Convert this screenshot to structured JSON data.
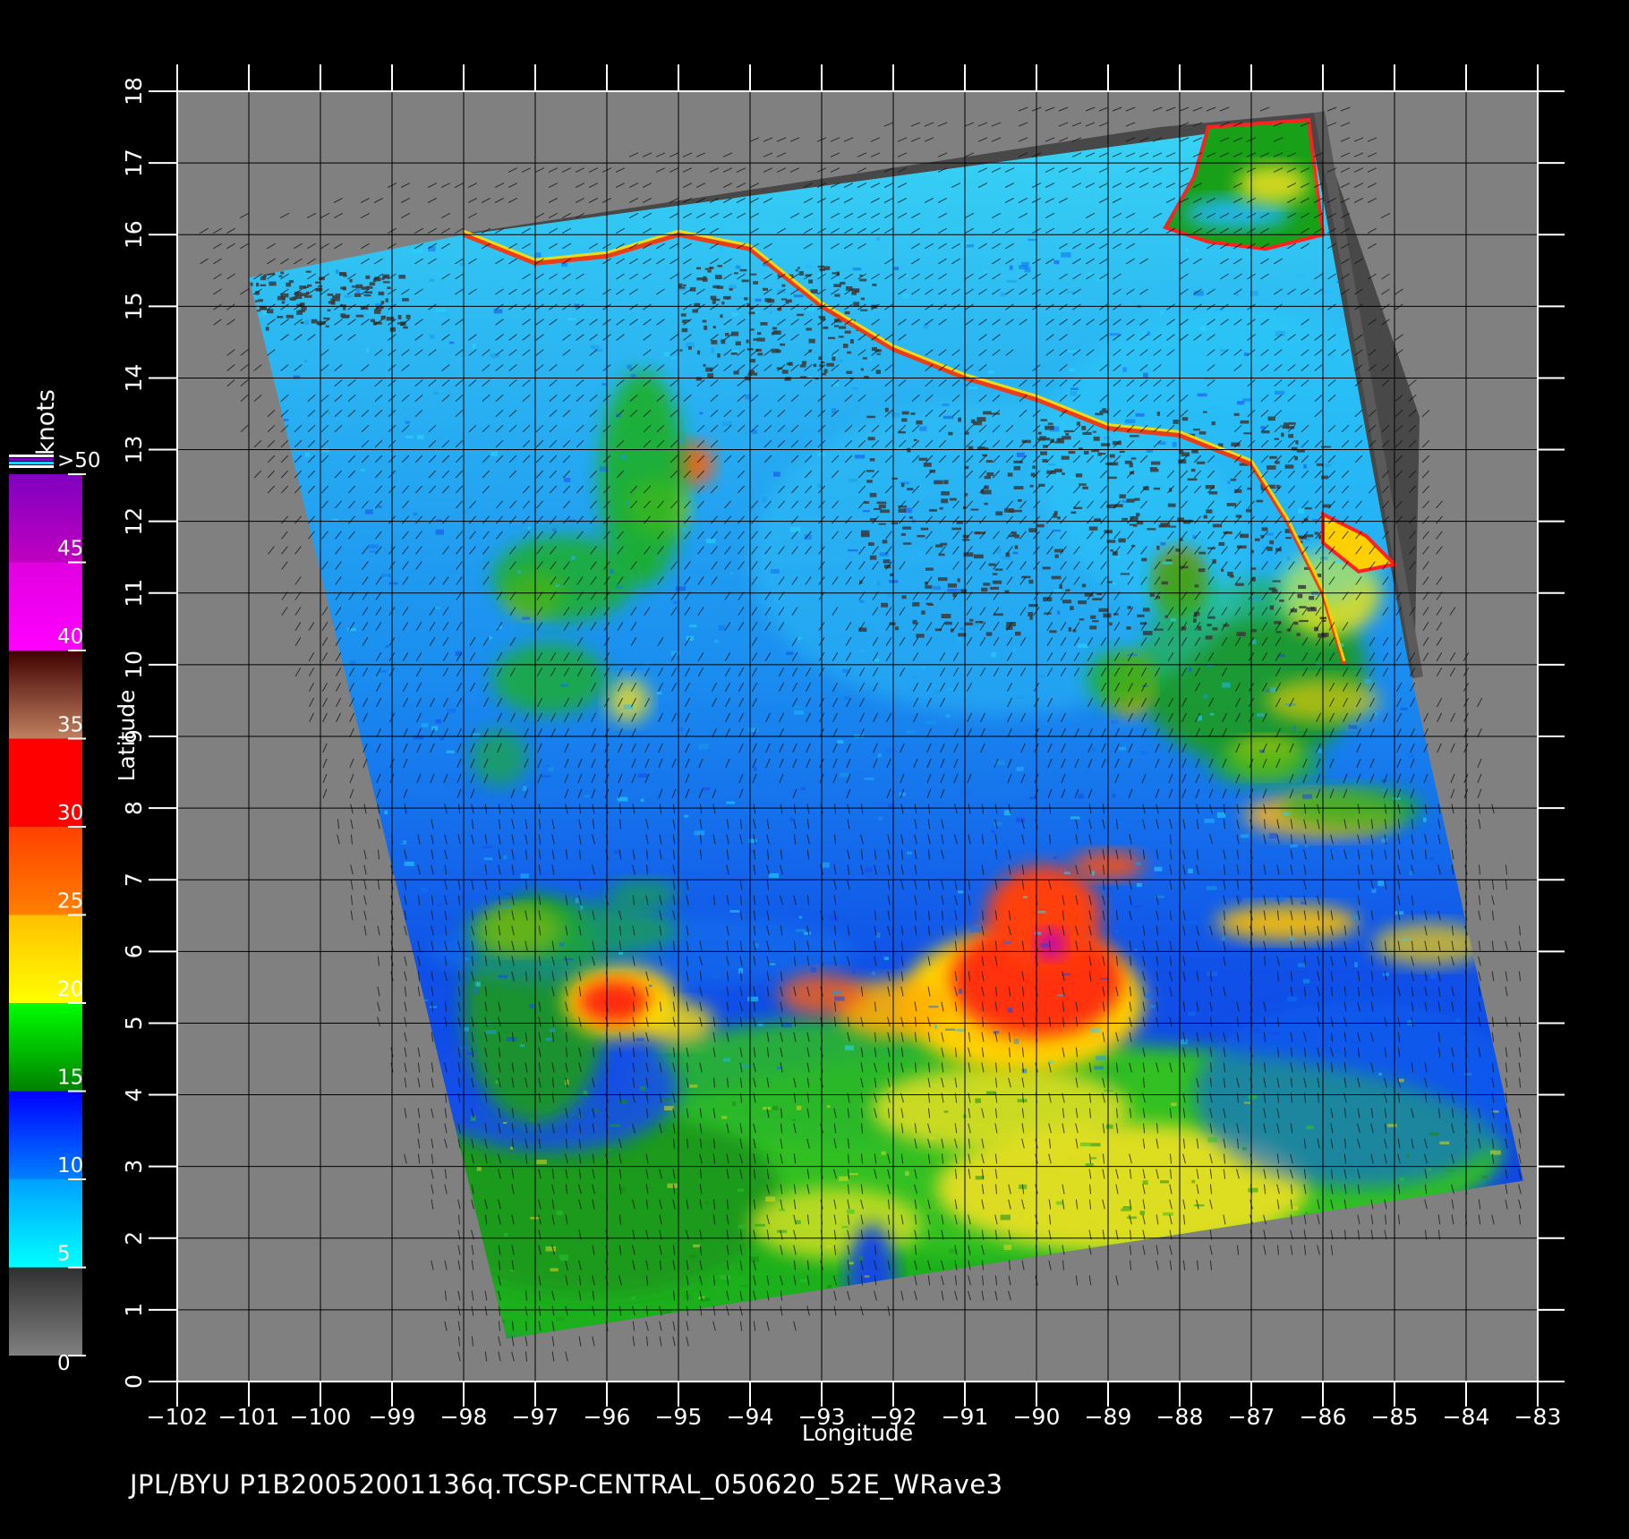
{
  "chart_data": {
    "type": "heatmap",
    "xlabel": "Longitude",
    "ylabel": "Latitude",
    "xlim": [
      -102,
      -83
    ],
    "ylim": [
      0,
      18
    ],
    "x_ticks": [
      "-102",
      "-101",
      "-100",
      "-99",
      "-98",
      "-97",
      "-96",
      "-95",
      "-94",
      "-93",
      "-92",
      "-91",
      "-90",
      "-89",
      "-88",
      "-87",
      "-86",
      "-85",
      "-84",
      "-83"
    ],
    "y_ticks": [
      "0",
      "1",
      "2",
      "3",
      "4",
      "5",
      "6",
      "7",
      "8",
      "9",
      "10",
      "11",
      "12",
      "13",
      "14",
      "15",
      "16",
      "17",
      "18"
    ],
    "grid": true,
    "colorbar": {
      "title": "knots",
      "ticks": [
        "0",
        "5",
        "10",
        "15",
        "20",
        "25",
        "30",
        "35",
        "40",
        "45",
        ">50"
      ],
      "bands": [
        {
          "from": 0,
          "to": 5,
          "colors": [
            "#808080",
            "#303030"
          ]
        },
        {
          "from": 5,
          "to": 10,
          "colors": [
            "#00ffff",
            "#00a0ff"
          ]
        },
        {
          "from": 10,
          "to": 15,
          "colors": [
            "#0080ff",
            "#0000ff"
          ]
        },
        {
          "from": 15,
          "to": 20,
          "colors": [
            "#008000",
            "#00ff00"
          ]
        },
        {
          "from": 20,
          "to": 25,
          "colors": [
            "#ffff00",
            "#ffc000"
          ]
        },
        {
          "from": 25,
          "to": 30,
          "colors": [
            "#ff8000",
            "#ff4000"
          ]
        },
        {
          "from": 30,
          "to": 35,
          "colors": [
            "#ff0000",
            "#ff0000"
          ]
        },
        {
          "from": 35,
          "to": 40,
          "colors": [
            "#c08060",
            "#400000"
          ]
        },
        {
          "from": 40,
          "to": 45,
          "colors": [
            "#ff00ff",
            "#e000e0"
          ]
        },
        {
          "from": 45,
          "to": 50,
          "colors": [
            "#c000c0",
            "#8000c0"
          ]
        }
      ]
    },
    "land_mask_color": "#4a4a4a",
    "no_data_color": "#808080",
    "swath_corners_lonlat": [
      [
        -101,
        15.4
      ],
      [
        -98,
        16.0
      ],
      [
        -86.2,
        17.6
      ],
      [
        -84.8,
        10.0
      ],
      [
        -83.2,
        2.8
      ],
      [
        -97.4,
        0.6
      ]
    ]
  },
  "footer": "JPL/BYU  P1B20052001136q.TCSP-CENTRAL_050620_52E_WRave3"
}
